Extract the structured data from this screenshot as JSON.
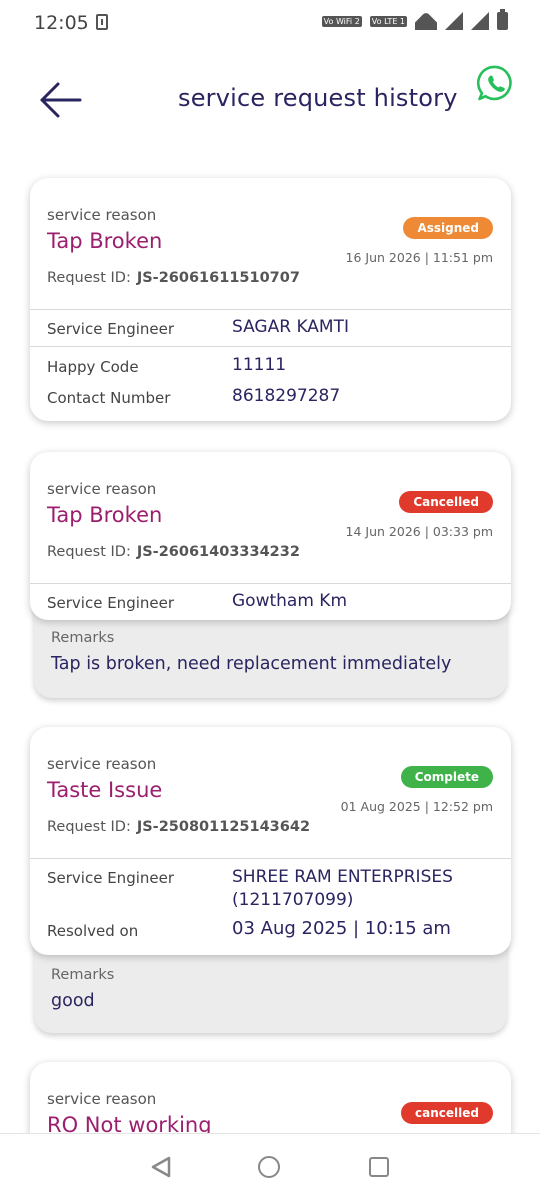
{
  "status": {
    "time": "12:05",
    "volte_wifi": "Vo WiFi 2",
    "volte_lte": "Vo LTE 1"
  },
  "header": {
    "title": "service request history",
    "back_icon": "arrow-left-icon",
    "whatsapp_icon": "whatsapp-icon"
  },
  "colors": {
    "accent": "#2a2560",
    "reason": "#9b1f6e",
    "assigned": "#ee8a35",
    "cancelled": "#e03a2d",
    "complete": "#3fb34a",
    "whatsapp": "#25c05a"
  },
  "requests": [
    {
      "reason_label": "service reason",
      "reason": "Tap Broken",
      "status": "Assigned",
      "date": "16 Jun 2026 | 11:51 pm",
      "request_id_label": "Request ID:",
      "request_id": "JS-26061611510707",
      "rows": [
        {
          "label": "Service Engineer",
          "value": "SAGAR KAMTI"
        },
        {
          "label": "Happy Code",
          "value": "11111"
        },
        {
          "label": "Contact Number",
          "value": "8618297287"
        }
      ]
    },
    {
      "reason_label": "service reason",
      "reason": "Tap Broken",
      "status": "Cancelled",
      "date": "14 Jun 2026 | 03:33 pm",
      "request_id_label": "Request ID:",
      "request_id": "JS-26061403334232",
      "rows": [
        {
          "label": "Service Engineer",
          "value": "Gowtham  Km"
        }
      ],
      "remarks_label": "Remarks",
      "remarks": "Tap is broken, need replacement immediately"
    },
    {
      "reason_label": "service reason",
      "reason": "Taste Issue",
      "status": "Complete",
      "date": "01 Aug 2025 | 12:52 pm",
      "request_id_label": "Request ID:",
      "request_id": "JS-250801125143642",
      "rows": [
        {
          "label": "Service Engineer",
          "value_line1": "SHREE RAM  ENTERPRISES",
          "value_line2": "(1211707099)"
        },
        {
          "label": "Resolved on",
          "value": "03 Aug 2025 | 10:15 am"
        }
      ],
      "remarks_label": "Remarks",
      "remarks": "good"
    },
    {
      "reason_label": "service reason",
      "reason": "RO Not working",
      "status": "cancelled"
    }
  ]
}
